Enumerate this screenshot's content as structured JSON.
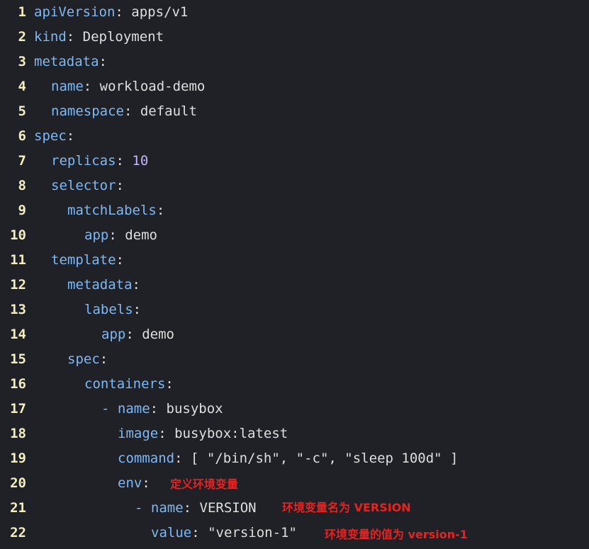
{
  "colors": {
    "background": "#202126",
    "line_number": "#f3eec0",
    "key": "#7eb8f5",
    "value": "#dfdfdf",
    "number": "#c6b5f7",
    "annotation": "#e82121"
  },
  "lines": [
    {
      "num": "1",
      "indent": 0,
      "key": "apiVersion",
      "value": "apps/v1",
      "value_type": "text"
    },
    {
      "num": "2",
      "indent": 0,
      "key": "kind",
      "value": "Deployment",
      "value_type": "text"
    },
    {
      "num": "3",
      "indent": 0,
      "key": "metadata",
      "value": "",
      "value_type": "text"
    },
    {
      "num": "4",
      "indent": 1,
      "key": "name",
      "value": "workload-demo",
      "value_type": "text"
    },
    {
      "num": "5",
      "indent": 1,
      "key": "namespace",
      "value": "default",
      "value_type": "text"
    },
    {
      "num": "6",
      "indent": 0,
      "key": "spec",
      "value": "",
      "value_type": "text"
    },
    {
      "num": "7",
      "indent": 1,
      "key": "replicas",
      "value": "10",
      "value_type": "number"
    },
    {
      "num": "8",
      "indent": 1,
      "key": "selector",
      "value": "",
      "value_type": "text"
    },
    {
      "num": "9",
      "indent": 2,
      "key": "matchLabels",
      "value": "",
      "value_type": "text"
    },
    {
      "num": "10",
      "indent": 3,
      "key": "app",
      "value": "demo",
      "value_type": "text"
    },
    {
      "num": "11",
      "indent": 1,
      "key": "template",
      "value": "",
      "value_type": "text"
    },
    {
      "num": "12",
      "indent": 2,
      "key": "metadata",
      "value": "",
      "value_type": "text"
    },
    {
      "num": "13",
      "indent": 3,
      "key": "labels",
      "value": "",
      "value_type": "text"
    },
    {
      "num": "14",
      "indent": 4,
      "key": "app",
      "value": "demo",
      "value_type": "text"
    },
    {
      "num": "15",
      "indent": 2,
      "key": "spec",
      "value": "",
      "value_type": "text"
    },
    {
      "num": "16",
      "indent": 3,
      "key": "containers",
      "value": "",
      "value_type": "text"
    },
    {
      "num": "17",
      "indent": 4,
      "dash": true,
      "key": "name",
      "value": "busybox",
      "value_type": "text"
    },
    {
      "num": "18",
      "indent": 5,
      "key": "image",
      "value": "busybox:latest",
      "value_type": "text"
    },
    {
      "num": "19",
      "indent": 5,
      "key": "command",
      "value": "[ \"/bin/sh\", \"-c\", \"sleep 100d\" ]",
      "value_type": "text"
    },
    {
      "num": "20",
      "indent": 5,
      "key": "env",
      "value": "",
      "value_type": "text",
      "annotation": "定义环境变量"
    },
    {
      "num": "21",
      "indent": 6,
      "dash": true,
      "key": "name",
      "value": "VERSION",
      "value_type": "text",
      "annotation": "环境变量名为 VERSION"
    },
    {
      "num": "22",
      "indent": 7,
      "key": "value",
      "value": "\"version-1\"",
      "value_type": "text",
      "annotation": "环境变量的值为 version-1"
    }
  ]
}
